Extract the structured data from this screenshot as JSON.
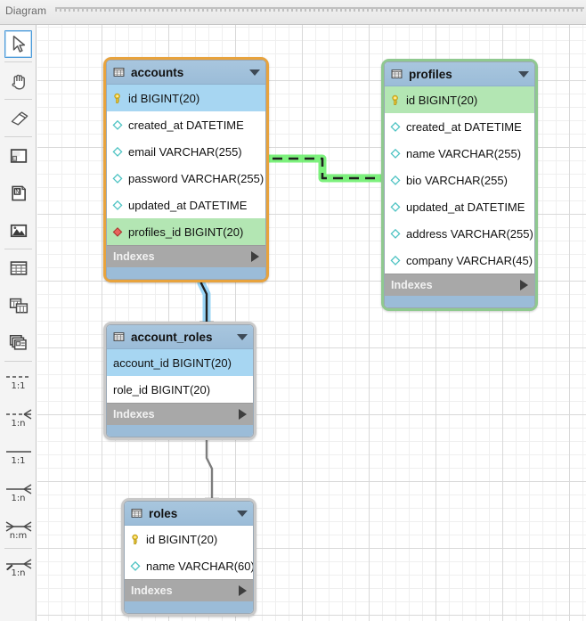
{
  "window": {
    "title": "Diagram"
  },
  "toolbar": {
    "tools": [
      {
        "name": "pointer-tool",
        "icon": "cursor-icon",
        "label": "",
        "selected": true,
        "sep": true
      },
      {
        "name": "hand-tool",
        "icon": "hand-icon",
        "label": "",
        "selected": false,
        "sep": true
      },
      {
        "name": "eraser-tool",
        "icon": "eraser-icon",
        "label": "",
        "selected": false,
        "sep": true
      },
      {
        "name": "layer-tool",
        "icon": "layer-icon",
        "label": "",
        "selected": false,
        "sep": false
      },
      {
        "name": "note-tool",
        "icon": "note-icon",
        "label": "",
        "selected": false,
        "sep": false
      },
      {
        "name": "image-tool",
        "icon": "image-icon",
        "label": "",
        "selected": false,
        "sep": true
      },
      {
        "name": "new-table-tool",
        "icon": "table-icon",
        "label": "",
        "selected": false,
        "sep": false
      },
      {
        "name": "new-view-tool",
        "icon": "view-icon",
        "label": "",
        "selected": false,
        "sep": false
      },
      {
        "name": "new-routine-tool",
        "icon": "routine-group-icon",
        "label": "",
        "selected": false,
        "sep": true
      }
    ],
    "relation_tools": [
      {
        "name": "relation-1-1-identifying-tool",
        "icon": "relation-dashed-1-1-icon",
        "label": "1:1",
        "style": "dashed",
        "crow": false,
        "sep": false
      },
      {
        "name": "relation-1-n-identifying-tool",
        "icon": "relation-dashed-1-n-icon",
        "label": "1:n",
        "style": "dashed",
        "crow": true,
        "sep": false
      },
      {
        "name": "relation-1-1-non-identifying-tool",
        "icon": "relation-solid-1-1-icon",
        "label": "1:1",
        "style": "solid",
        "crow": false,
        "sep": false
      },
      {
        "name": "relation-1-n-non-identifying-tool",
        "icon": "relation-solid-1-n-icon",
        "label": "1:n",
        "style": "solid",
        "crow": true,
        "sep": false
      },
      {
        "name": "relation-n-m-tool",
        "icon": "relation-n-m-icon",
        "label": "n:m",
        "style": "solid",
        "crow": true,
        "sep": true
      },
      {
        "name": "relation-pick-columns-tool",
        "icon": "relation-pick-1-n-icon",
        "label": "1:n",
        "style": "solid",
        "crow": true,
        "sep": false
      }
    ]
  },
  "colors": {
    "selected_table_border": "#e8a33d",
    "related_table_border": "#8fc98f",
    "table_header": "#9bbcd8",
    "pk_row_highlight": "#a7d6f2",
    "fk_row_highlight": "#b3e6b3",
    "index_row": "#a8a8a8",
    "selected_relation_green": "#2fd42f",
    "selected_relation_blue": "#4fa3e0",
    "unselected_relation": "#7d7d7d",
    "canvas_grid": "#d9d9d9"
  },
  "diagram": {
    "tables": [
      {
        "name": "accounts",
        "icon": "table-icon",
        "caret": "chevron-down-icon",
        "selection": "sel-orange",
        "indexes_label": "Indexes",
        "indexes_arrow": "chevron-right-icon",
        "columns": [
          {
            "label": "id BIGINT(20)",
            "icon": "primary-key-icon",
            "row": "pk-hl"
          },
          {
            "label": "created_at DATETIME",
            "icon": "column-icon",
            "row": ""
          },
          {
            "label": "email VARCHAR(255)",
            "icon": "column-icon",
            "row": ""
          },
          {
            "label": "password VARCHAR(255)",
            "icon": "column-icon",
            "row": ""
          },
          {
            "label": "updated_at DATETIME",
            "icon": "column-icon",
            "row": ""
          },
          {
            "label": "profiles_id BIGINT(20)",
            "icon": "foreign-key-icon",
            "row": "fk-hl"
          }
        ]
      },
      {
        "name": "profiles",
        "icon": "table-icon",
        "caret": "chevron-down-icon",
        "selection": "sel-green",
        "indexes_label": "Indexes",
        "indexes_arrow": "chevron-right-icon",
        "columns": [
          {
            "label": "id BIGINT(20)",
            "icon": "primary-key-icon",
            "row": "pk-grn"
          },
          {
            "label": "created_at DATETIME",
            "icon": "column-icon",
            "row": ""
          },
          {
            "label": "name VARCHAR(255)",
            "icon": "column-icon",
            "row": ""
          },
          {
            "label": "bio VARCHAR(255)",
            "icon": "column-icon",
            "row": ""
          },
          {
            "label": "updated_at DATETIME",
            "icon": "column-icon",
            "row": ""
          },
          {
            "label": "address VARCHAR(255)",
            "icon": "column-icon",
            "row": ""
          },
          {
            "label": "company VARCHAR(45)",
            "icon": "column-icon",
            "row": ""
          }
        ]
      },
      {
        "name": "account_roles",
        "icon": "table-icon",
        "caret": "chevron-down-icon",
        "selection": "sel-gray",
        "indexes_label": "Indexes",
        "indexes_arrow": "chevron-right-icon",
        "columns": [
          {
            "label": "account_id BIGINT(20)",
            "icon": "none",
            "row": "plain-hl"
          },
          {
            "label": "role_id BIGINT(20)",
            "icon": "none",
            "row": ""
          }
        ]
      },
      {
        "name": "roles",
        "icon": "table-icon",
        "caret": "chevron-down-icon",
        "selection": "sel-gray",
        "indexes_label": "Indexes",
        "indexes_arrow": "chevron-right-icon",
        "columns": [
          {
            "label": "id BIGINT(20)",
            "icon": "primary-key-icon",
            "row": ""
          },
          {
            "label": "name VARCHAR(60)",
            "icon": "column-icon",
            "row": ""
          }
        ]
      }
    ],
    "relationships": [
      {
        "name": "relation-accounts-profiles",
        "from": "accounts",
        "to": "profiles",
        "cardinality": "1:1",
        "state": "selected-green"
      },
      {
        "name": "relation-accounts-account-roles",
        "from": "accounts",
        "to": "account_roles",
        "cardinality": "1:n",
        "state": "selected-blue"
      },
      {
        "name": "relation-roles-account-roles",
        "from": "account_roles",
        "to": "roles",
        "cardinality": "1:n",
        "state": "normal"
      }
    ]
  }
}
